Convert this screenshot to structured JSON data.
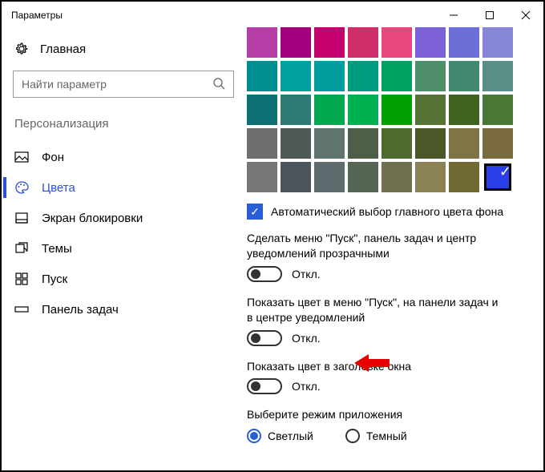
{
  "window": {
    "title": "Параметры"
  },
  "sidebar": {
    "home": "Главная",
    "search_placeholder": "Найти параметр",
    "section": "Персонализация",
    "items": [
      {
        "label": "Фон"
      },
      {
        "label": "Цвета"
      },
      {
        "label": "Экран блокировки"
      },
      {
        "label": "Темы"
      },
      {
        "label": "Пуск"
      },
      {
        "label": "Панель задач"
      }
    ]
  },
  "colors": {
    "palette": [
      [
        "#b63fa7",
        "#a2007e",
        "#c4006f",
        "#cf2e6a",
        "#e8467c",
        "#7b60d8",
        "#6e6ed8",
        "#8886d9"
      ],
      [
        "#008f8f",
        "#00a0a0",
        "#009e9e",
        "#009b7e",
        "#00a060",
        "#4f8f6a",
        "#418a70",
        "#5a8f87"
      ],
      [
        "#0e6f74",
        "#2e7a72",
        "#00a84f",
        "#00b050",
        "#00a000",
        "#567335",
        "#3f6420",
        "#4a7735"
      ],
      [
        "#6f6f6f",
        "#4e5a53",
        "#5f746d",
        "#4f5f47",
        "#4e6b2f",
        "#4a5726",
        "#7e7445",
        "#7a6a3f"
      ],
      [
        "#767676",
        "#4a545a",
        "#5f6c6f",
        "#556655",
        "#707050",
        "#8a8255",
        "#726a33",
        "#2a3fe8"
      ]
    ],
    "selected_row": 4,
    "selected_col": 7,
    "auto_accent_checked": true,
    "auto_accent_label": "Автоматический выбор главного цвета фона",
    "opt1_label": "Сделать меню \"Пуск\", панель задач и центр уведомлений прозрачными",
    "opt1_state": "Откл.",
    "opt2_label": "Показать цвет в меню \"Пуск\", на панели задач и в центре уведомлений",
    "opt2_state": "Откл.",
    "opt3_label": "Показать цвет в заголовке окна",
    "opt3_state": "Откл.",
    "mode_label": "Выберите режим приложения",
    "mode_light": "Светлый",
    "mode_dark": "Темный",
    "mode_selected": "light"
  }
}
